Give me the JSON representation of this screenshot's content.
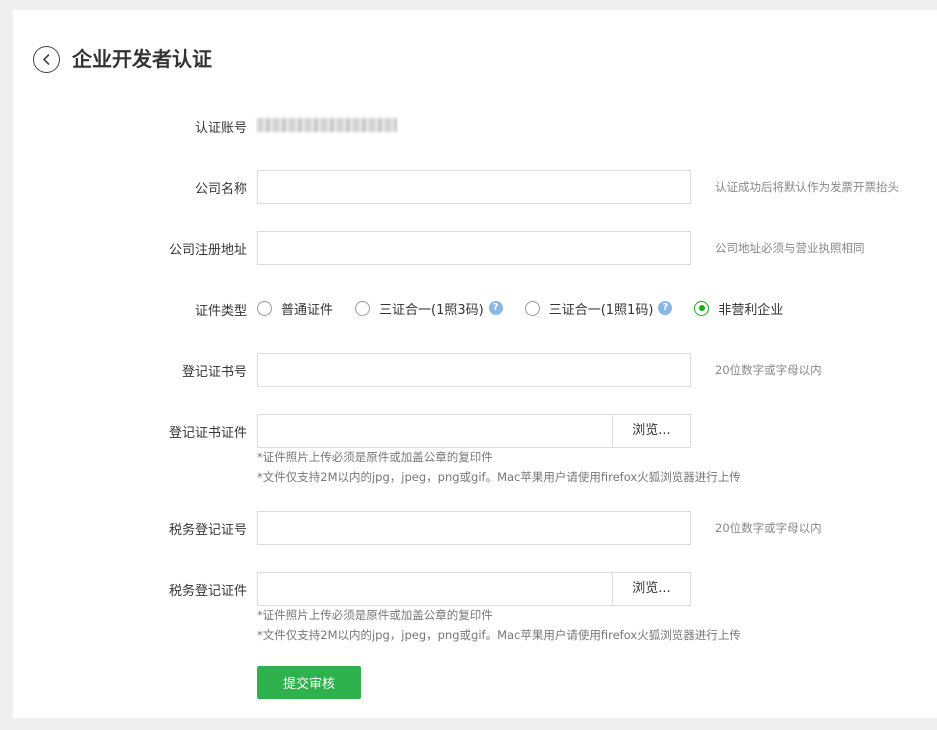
{
  "header": {
    "title": "企业开发者认证"
  },
  "account": {
    "label": "认证账号"
  },
  "company_name": {
    "label": "公司名称",
    "value": "",
    "hint": "认证成功后将默认作为发票开票抬头"
  },
  "company_address": {
    "label": "公司注册地址",
    "value": "",
    "hint": "公司地址必须与营业执照相同"
  },
  "cert_type": {
    "label": "证件类型",
    "options": [
      {
        "label": "普通证件",
        "help": false
      },
      {
        "label": "三证合一(1照3码)",
        "help": true
      },
      {
        "label": "三证合一(1照1码)",
        "help": true
      },
      {
        "label": "非营利企业",
        "help": false
      }
    ],
    "selected": "非营利企业",
    "help_icon": "question-icon"
  },
  "reg_cert_no": {
    "label": "登记证书号",
    "value": "",
    "hint": "20位数字或字母以内"
  },
  "reg_cert_file": {
    "label": "登记证书证件",
    "browse_label": "浏览...",
    "note1": "*证件照片上传必须是原件或加盖公章的复印件",
    "note2": "*文件仅支持2M以内的jpg，jpeg，png或gif。Mac苹果用户请使用firefox火狐浏览器进行上传"
  },
  "tax_reg_no": {
    "label": "税务登记证号",
    "value": "",
    "hint": "20位数字或字母以内"
  },
  "tax_reg_file": {
    "label": "税务登记证件",
    "browse_label": "浏览...",
    "note1": "*证件照片上传必须是原件或加盖公章的复印件",
    "note2": "*文件仅支持2M以内的jpg，jpeg，png或gif。Mac苹果用户请使用firefox火狐浏览器进行上传"
  },
  "submit": {
    "label": "提交审核",
    "color": "#2fb24e"
  },
  "colors": {
    "radio_checked": "#1aad19",
    "help_icon": "#8ab6e4"
  }
}
